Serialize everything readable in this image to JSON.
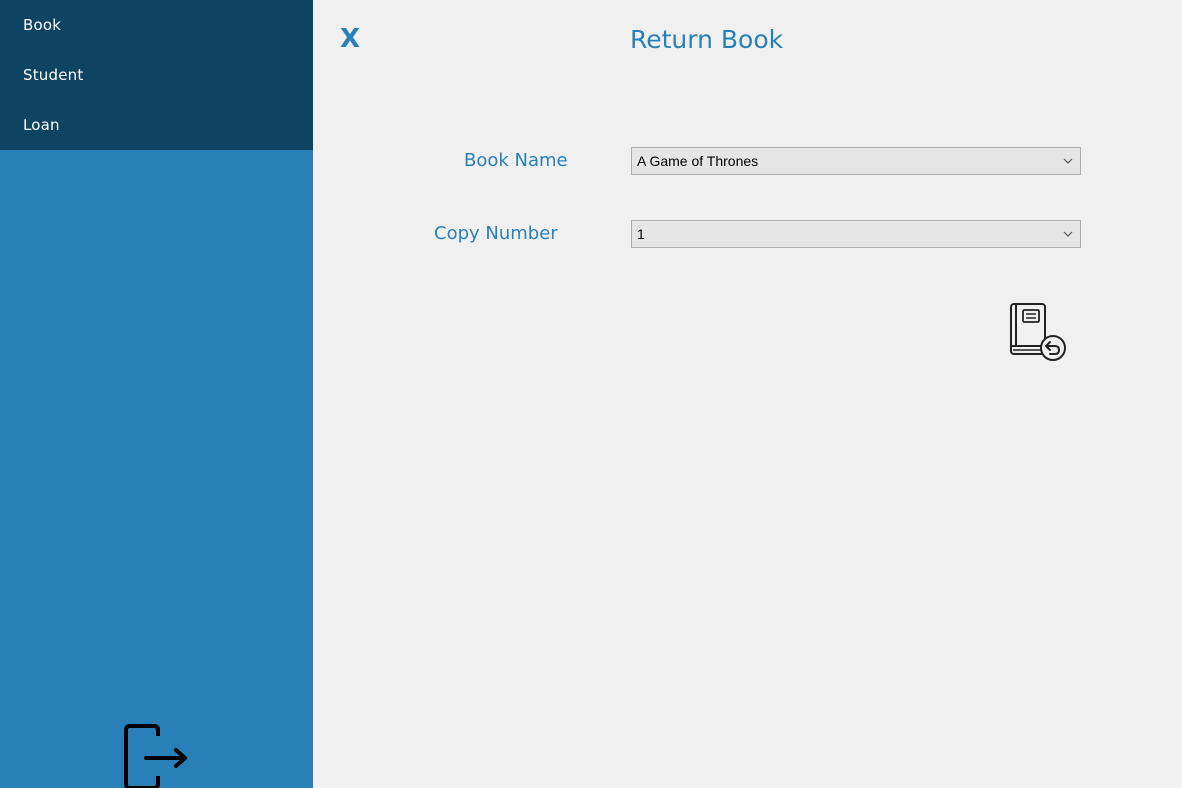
{
  "sidebar": {
    "items": [
      {
        "label": "Book"
      },
      {
        "label": "Student"
      },
      {
        "label": "Loan"
      }
    ],
    "logout_icon": "logout-icon"
  },
  "header": {
    "close_label": "X",
    "title": "Return Book"
  },
  "form": {
    "book_name": {
      "label": "Book Name",
      "value": "A Game of Thrones"
    },
    "copy_number": {
      "label": "Copy Number",
      "value": "1"
    },
    "return_icon": "return-book-icon"
  },
  "colors": {
    "sidebar": "#2980b9",
    "sidebar_menu": "#0e4461",
    "accent": "#2980b9",
    "background": "#f0f0f0"
  }
}
